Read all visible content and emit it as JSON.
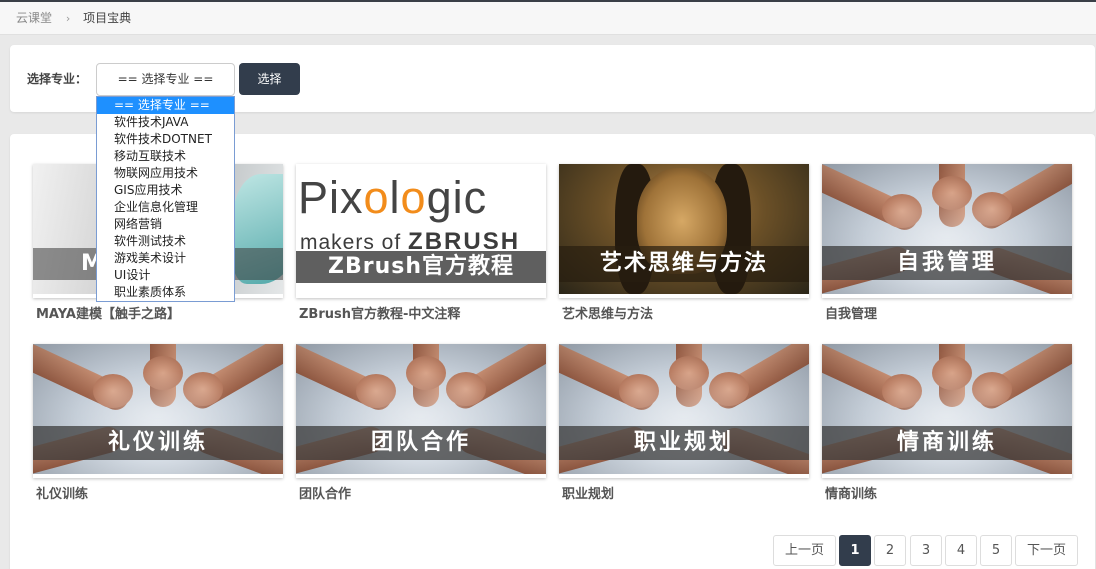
{
  "breadcrumb": {
    "home": "云课堂",
    "separator": "›",
    "current": "项目宝典"
  },
  "filter": {
    "label": "选择专业：",
    "selected": "== 选择专业 ==",
    "button_label": "选择",
    "options": [
      "== 选择专业 ==",
      "软件技术JAVA",
      "软件技术DOTNET",
      "移动互联技术",
      "物联网应用技术",
      "GIS应用技术",
      "企业信息化管理",
      "网络营销",
      "软件测试技术",
      "游戏美术设计",
      "UI设计",
      "职业素质体系"
    ]
  },
  "courses": [
    {
      "title": "MAYA建模【触手之路】",
      "overlay": "M",
      "image": "maya-render"
    },
    {
      "title": "ZBrush官方教程-中文注释",
      "logo": "Pixologic",
      "tagline_prefix": "makers of ",
      "tagline_brand": "ZBRUSH",
      "overlay": "ZBrush官方教程",
      "image": "pixologic-logo"
    },
    {
      "title": "艺术思维与方法",
      "overlay": "艺术思维与方法",
      "image": "mona-lisa"
    },
    {
      "title": "自我管理",
      "overlay": "自我管理",
      "image": "hands-circle"
    },
    {
      "title": "礼仪训练",
      "overlay": "礼仪训练",
      "image": "hands-circle"
    },
    {
      "title": "团队合作",
      "overlay": "团队合作",
      "image": "hands-circle"
    },
    {
      "title": "职业规划",
      "overlay": "职业规划",
      "image": "hands-circle"
    },
    {
      "title": "情商训练",
      "overlay": "情商训练",
      "image": "hands-circle"
    }
  ],
  "pagination": {
    "prev": "上一页",
    "next": "下一页",
    "pages": [
      "1",
      "2",
      "3",
      "4",
      "5"
    ],
    "current": "1"
  },
  "colors": {
    "accent": "#323d4c",
    "dropdown_highlight": "#1e90ff",
    "pixologic_orange": "#f28c1b"
  }
}
